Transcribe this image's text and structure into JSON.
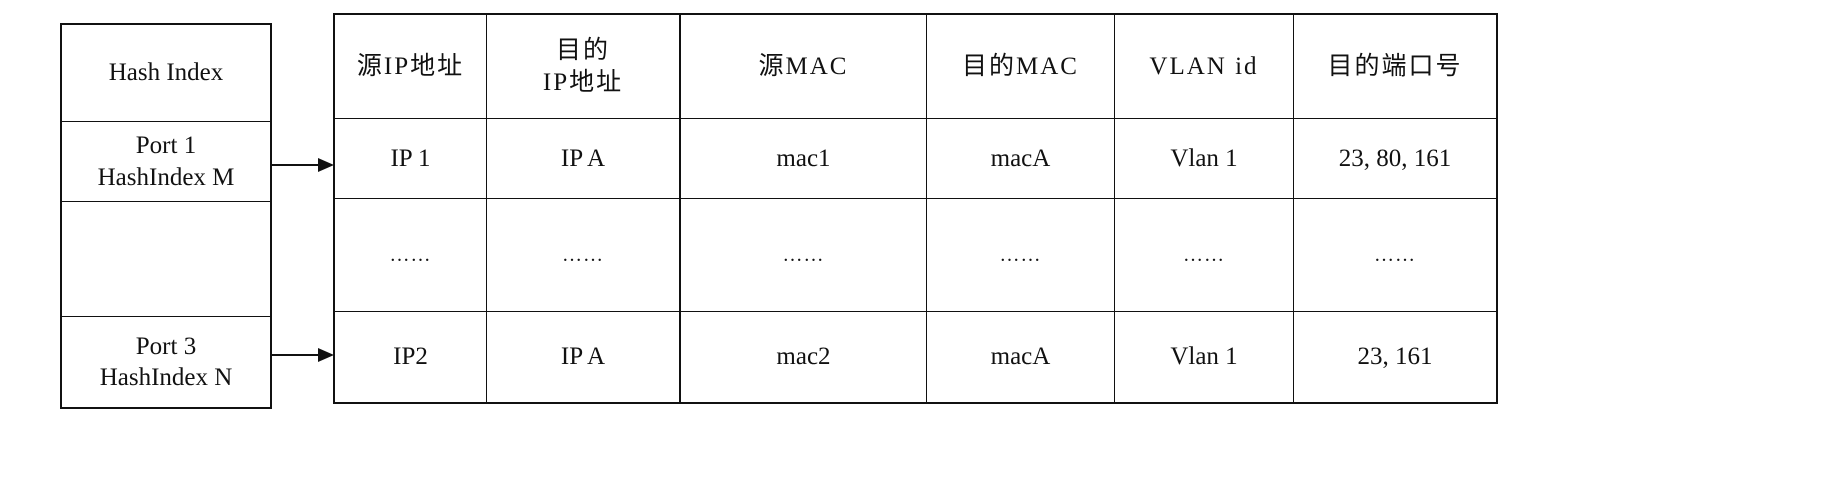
{
  "diagram": {
    "hash_table": {
      "header": "Hash Index",
      "entries": [
        {
          "label": "Port 1\nHashIndex M"
        },
        {
          "label": ""
        },
        {
          "label": "Port 3\nHashIndex N"
        }
      ]
    },
    "flow_table": {
      "columns": [
        "源IP地址",
        "目的\nIP地址",
        "源MAC",
        "目的MAC",
        "VLAN id",
        "目的端口号"
      ],
      "rows": [
        [
          "IP 1",
          "IP A",
          "mac1",
          "macA",
          "Vlan 1",
          "23, 80, 161"
        ],
        [
          "……",
          "……",
          "……",
          "……",
          "……",
          "……"
        ],
        [
          "IP2",
          "IP A",
          "mac2",
          "macA",
          "Vlan 1",
          "23, 161"
        ]
      ]
    },
    "arrows": [
      {
        "from": "Port 1 HashIndex M",
        "to": "IP 1 row"
      },
      {
        "from": "Port 3 HashIndex N",
        "to": "IP2 row"
      }
    ]
  }
}
